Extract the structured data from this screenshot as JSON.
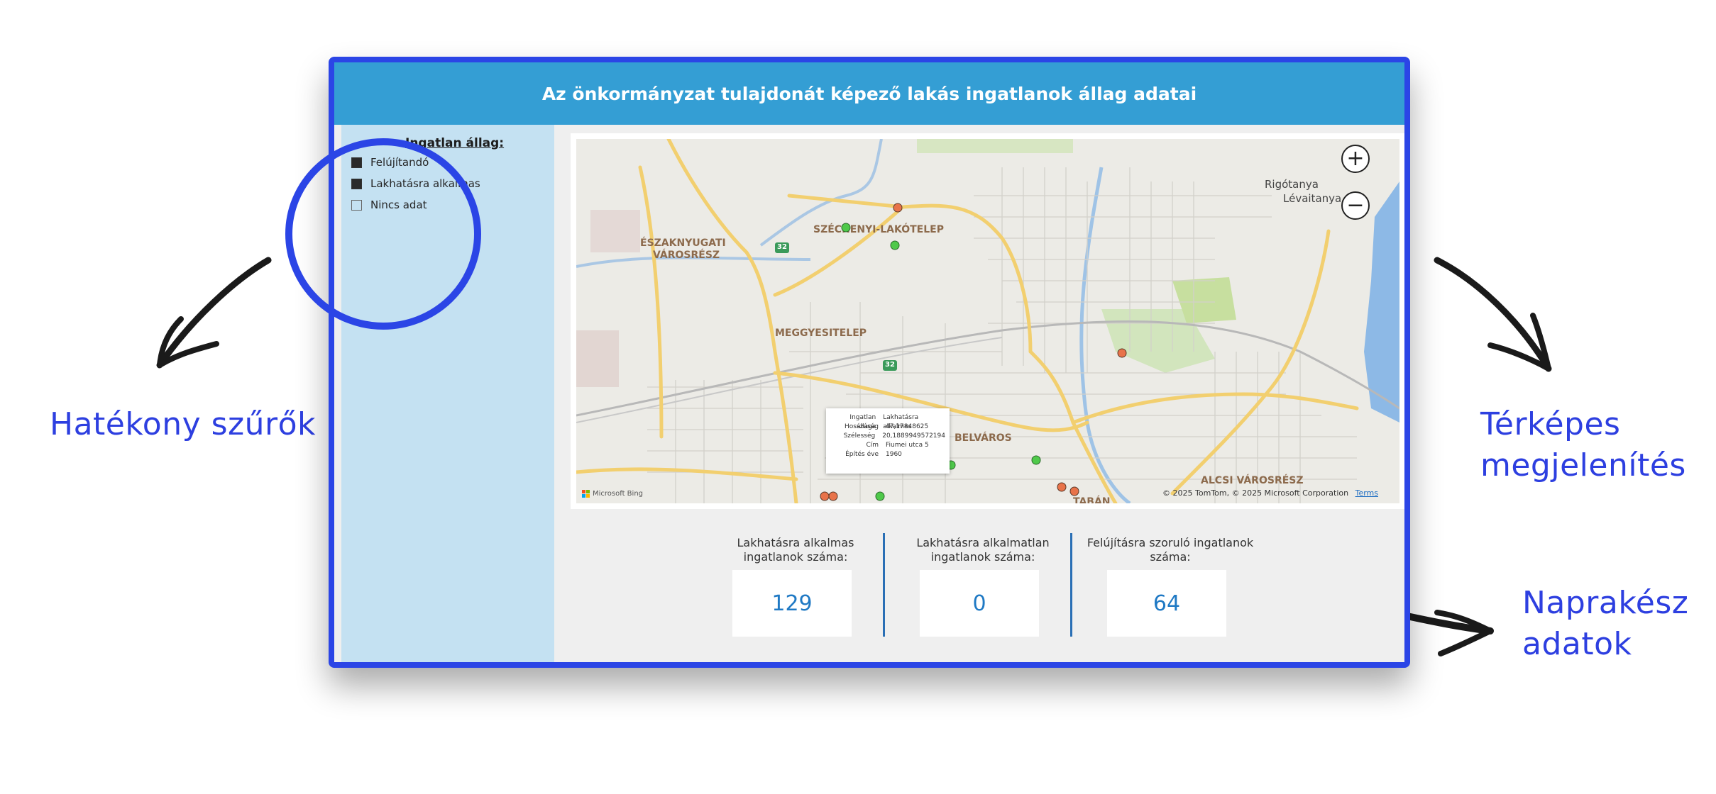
{
  "callouts": {
    "left": "Hatékony szűrők",
    "right_line1": "Térképes",
    "right_line2": "megjelenítés",
    "bottom_line1": "Naprakész",
    "bottom_line2": "adatok"
  },
  "header": {
    "title": "Az önkormányzat tulajdonát képező lakás ingatlanok állag adatai"
  },
  "legend": {
    "title": "Ingatlan állag:",
    "items": [
      {
        "label": "Felújítandó",
        "color": "#2a2a2a"
      },
      {
        "label": "Lakhatásra alkalmas",
        "color": "#2a2a2a"
      },
      {
        "label": "Nincs adat",
        "color": "#c4e1f2"
      }
    ]
  },
  "map": {
    "labels": {
      "szechenyi": "SZÉCHENYI-LAKÓTELEP",
      "eszaknyugati_1": "ÉSZAKNYUGATI",
      "eszaknyugati_2": "VÁROSRÉSZ",
      "meggyesi": "MEGGYESITELEP",
      "belvaros": "BELVÁROS",
      "alcsi": "ALCSI VÁROSRÉSZ",
      "taban": "TABÁN",
      "rigotanya": "Rigótanya",
      "levaitanya": "Lévaitanya",
      "route_32_a": "32",
      "route_32_b": "32"
    },
    "zoom_in": "+",
    "zoom_out": "−",
    "tooltip": [
      {
        "key": "Ingatlan állaga",
        "value": "Lakhatásra alkalmas"
      },
      {
        "key": "Hosszúság",
        "value": "47,17848625"
      },
      {
        "key": "Szélesség",
        "value": "20,1889949572194"
      },
      {
        "key": "Cím",
        "value": "Fiumei utca 5"
      },
      {
        "key": "Építés éve",
        "value": "1960"
      }
    ],
    "attribution": "© 2025 TomTom, © 2025 Microsoft Corporation",
    "terms": "Terms",
    "provider": "Microsoft Bing",
    "marker_colors": {
      "felujitando": "#e8734a",
      "lakhatasra": "#4fc94a"
    }
  },
  "kpis": [
    {
      "label": "Lakhatásra alkalmas ingatlanok száma:",
      "value": "129"
    },
    {
      "label": "Lakhatásra alkalmatlan ingatlanok száma:",
      "value": "0"
    },
    {
      "label": "Felújításra szoruló ingatlanok száma:",
      "value": "64"
    }
  ],
  "colors": {
    "accent": "#2b45e6",
    "header": "#349ed4",
    "sidebar": "#c4e1f2",
    "kpi_value": "#1f79c4"
  }
}
